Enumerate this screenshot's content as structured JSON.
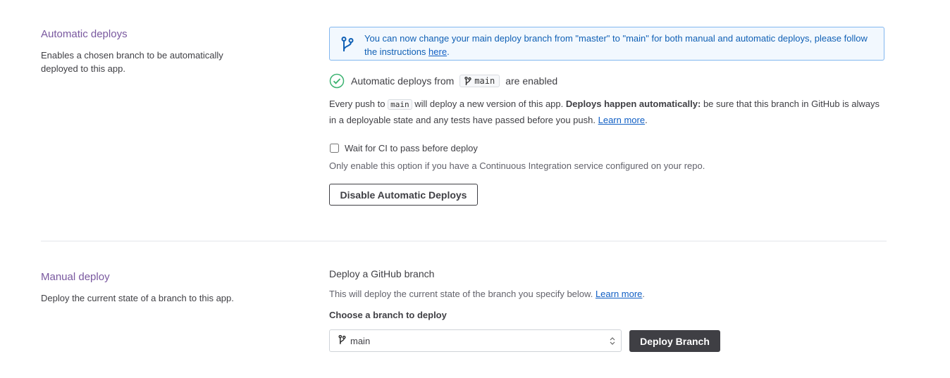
{
  "automatic": {
    "title": "Automatic deploys",
    "description": "Enables a chosen branch to be automatically deployed to this app.",
    "notice_text": "You can now change your main deploy branch from \"master\" to \"main\" for both manual and automatic deploys, please follow the instructions ",
    "notice_link": "here",
    "notice_end": ".",
    "status_prefix": "Automatic deploys from",
    "status_branch": "main",
    "status_suffix": "are enabled",
    "push_prefix": "Every push to",
    "push_branch": "main",
    "push_middle": "will deploy a new version of this app.",
    "push_bold": "Deploys happen automatically:",
    "push_rest": "be sure that this branch in GitHub is always in a deployable state and any tests have passed before you push.",
    "push_link": "Learn more",
    "push_end": ".",
    "ci_label": "Wait for CI to pass before deploy",
    "ci_checked": false,
    "ci_help": "Only enable this option if you have a Continuous Integration service configured on your repo.",
    "disable_button": "Disable Automatic Deploys"
  },
  "manual": {
    "title": "Manual deploy",
    "description": "Deploy the current state of a branch to this app.",
    "heading": "Deploy a GitHub branch",
    "desc_text": "This will deploy the current state of the branch you specify below.",
    "desc_link": "Learn more",
    "desc_end": ".",
    "choose_label": "Choose a branch to deploy",
    "selected_branch": "main",
    "deploy_button": "Deploy Branch"
  },
  "colors": {
    "accent_purple": "#79589f",
    "link_blue": "#0f5ec4",
    "success_green": "#3cb371",
    "dark_button": "#3f3f44"
  },
  "icons": [
    "branch-icon",
    "check-circle-icon",
    "select-caret-icon"
  ]
}
